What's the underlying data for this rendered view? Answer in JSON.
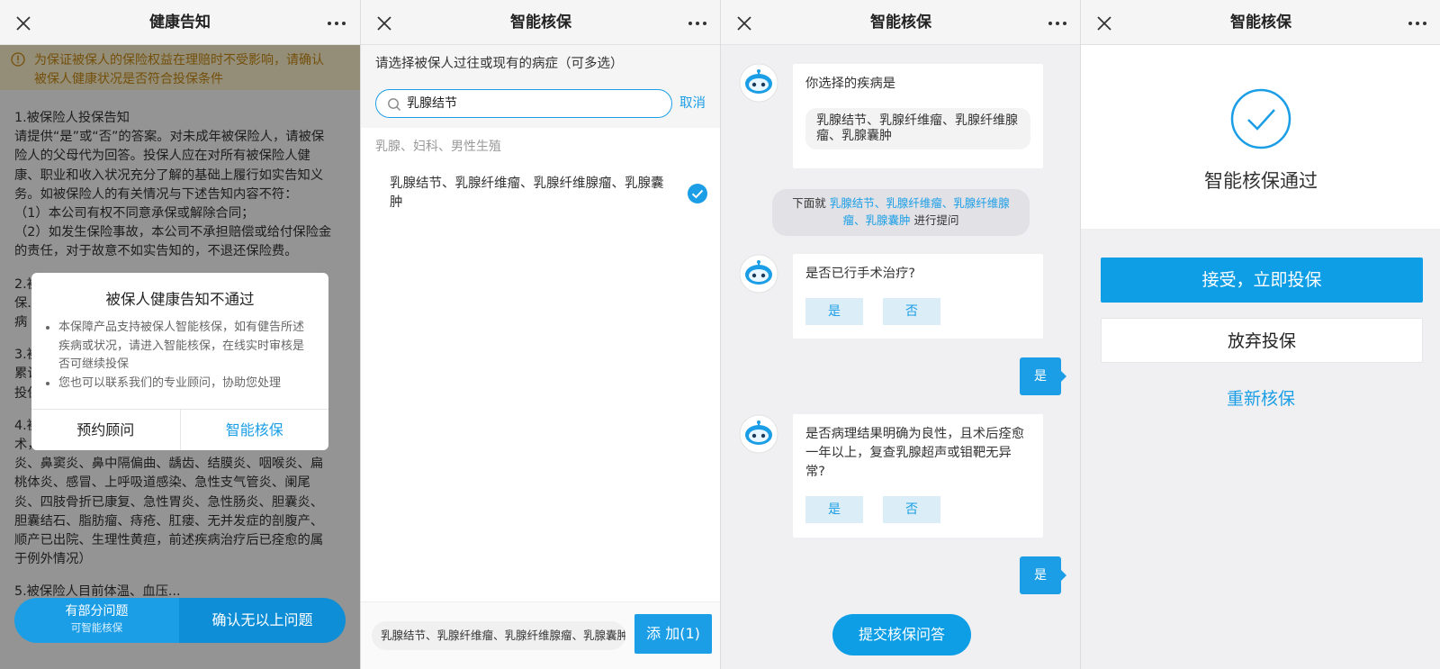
{
  "colors": {
    "accent": "#1b9ee6",
    "warn": "#c98a14",
    "overlay": "rgba(0,0,0,0.42)"
  },
  "panel1": {
    "title": "健康告知",
    "warning": [
      "为保证被保人的保险权益在理赔时不受影响，请确认",
      "被保人健康状况是否符合投保条件"
    ],
    "paragraphs": [
      [
        "1.被保险人投保告知",
        "请提供“是”或“否”的答案。对未成年被保险人，请被保",
        "险人的父母代为回答。投保人应在对所有被保险人健",
        "康、职业和收入状况充分了解的基础上履行如实告知义",
        "务。如被保险人的有关情况与下述告知内容不符：",
        "（1）本公司有权不同意承保或解除合同；",
        "（2）如发生保险事故，本公司不承担赔偿或给付保险金",
        "的责任，对于故意不如实告知的，不退还保险费。"
      ],
      [
        "2.被",
        "保...",
        "病"
      ],
      [
        "3.被",
        "累计",
        "投保"
      ],
      [
        "4.被",
        "术，或由体检医师或医生提出住院或手术的建议？（鼻",
        "炎、鼻窦炎、鼻中隔偏曲、龋齿、结膜炎、咽喉炎、扁",
        "桃体炎、感冒、上呼吸道感染、急性支气管炎、阑尾",
        "炎、四肢骨折已康复、急性胃炎、急性肠炎、胆囊炎、",
        "胆囊结石、脂肪瘤、痔疮、肛瘘、无并发症的剖腹产、",
        "顺产已出院、生理性黄疸，前述疾病治疗后已痊愈的属",
        "于例外情况）"
      ],
      [
        "5.被保险人目前体温、血压..."
      ]
    ],
    "dialog": {
      "title": "被保人健康告知不通过",
      "items": [
        "本保障产品支持被保人智能核保，如有健告所述疾病或状况，请进入智能核保，在线实时审核是否可继续投保",
        "您也可以联系我们的专业顾问，协助您处理"
      ],
      "btn_left": "预约顾问",
      "btn_right": "智能核保"
    },
    "bottom_left_main": "有部分问题",
    "bottom_left_sub": "可智能核保",
    "bottom_right": "确认无以上问题"
  },
  "panel2": {
    "title": "智能核保",
    "prompt": "请选择被保人过往或现有的病症（可多选）",
    "search_value": "乳腺结节",
    "cancel": "取消",
    "category": "乳腺、妇科、男性生殖",
    "item": "乳腺结节、乳腺纤维瘤、乳腺纤维腺瘤、乳腺囊肿",
    "selected_preview": "乳腺结节、乳腺纤维瘤、乳腺纤维腺瘤、乳腺囊肿",
    "add_button": "添 加(1)"
  },
  "panel3": {
    "title": "智能核保",
    "bubble1_text": "你选择的疾病是",
    "bubble1_inner": "乳腺结节、乳腺纤维瘤、乳腺纤维腺瘤、乳腺囊肿",
    "note_prefix": "下面就 ",
    "note_highlight": "乳腺结节、乳腺纤维瘤、乳腺纤维腺瘤、乳腺囊肿",
    "note_suffix": " 进行提问",
    "q1": "是否已行手术治疗?",
    "q2": "是否病理结果明确为良性，且术后痊愈一年以上，复查乳腺超声或钼靶无异常?",
    "yes": "是",
    "no": "否",
    "reply1": "是",
    "reply2": "是",
    "submit": "提交核保问答"
  },
  "panel4": {
    "title": "智能核保",
    "result": "智能核保通过",
    "accept": "接受，立即投保",
    "abandon": "放弃投保",
    "redo": "重新核保"
  }
}
